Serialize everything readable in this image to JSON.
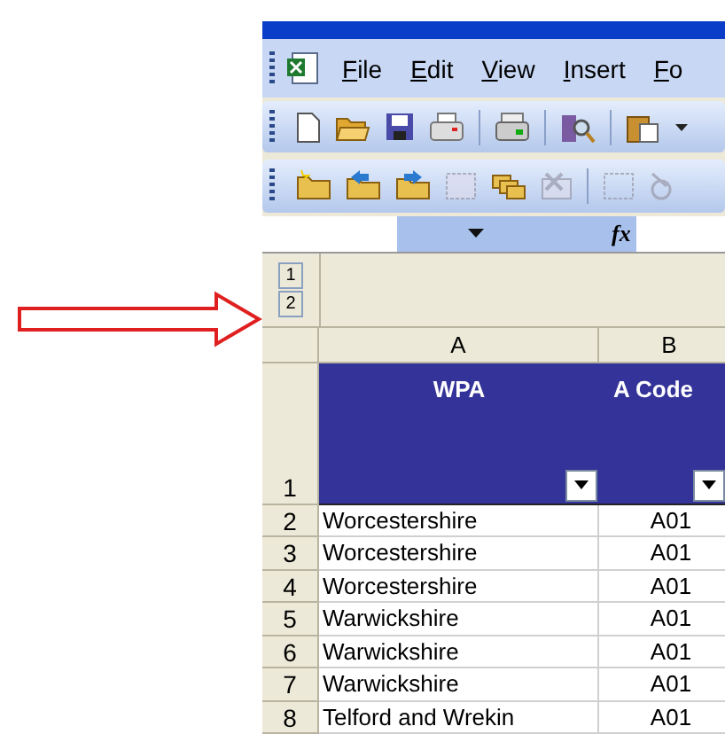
{
  "menu": [
    {
      "label": "File"
    },
    {
      "label": "Edit"
    },
    {
      "label": "View"
    },
    {
      "label": "Insert"
    },
    {
      "label": "Fo"
    }
  ],
  "formula_bar": {
    "fx": "fx"
  },
  "outline_levels": [
    "1",
    "2"
  ],
  "columns": [
    "A",
    "B"
  ],
  "header_row": {
    "number": "1",
    "cells": [
      "WPA",
      "A Code"
    ]
  },
  "rows": [
    {
      "number": "2",
      "cells": [
        "Worcestershire",
        "A01"
      ]
    },
    {
      "number": "3",
      "cells": [
        "Worcestershire",
        "A01"
      ]
    },
    {
      "number": "4",
      "cells": [
        "Worcestershire",
        "A01"
      ]
    },
    {
      "number": "5",
      "cells": [
        "Warwickshire",
        "A01"
      ]
    },
    {
      "number": "6",
      "cells": [
        "Warwickshire",
        "A01"
      ]
    },
    {
      "number": "7",
      "cells": [
        "Warwickshire",
        "A01"
      ]
    },
    {
      "number": "8",
      "cells": [
        "Telford and Wrekin",
        "A01"
      ]
    }
  ]
}
